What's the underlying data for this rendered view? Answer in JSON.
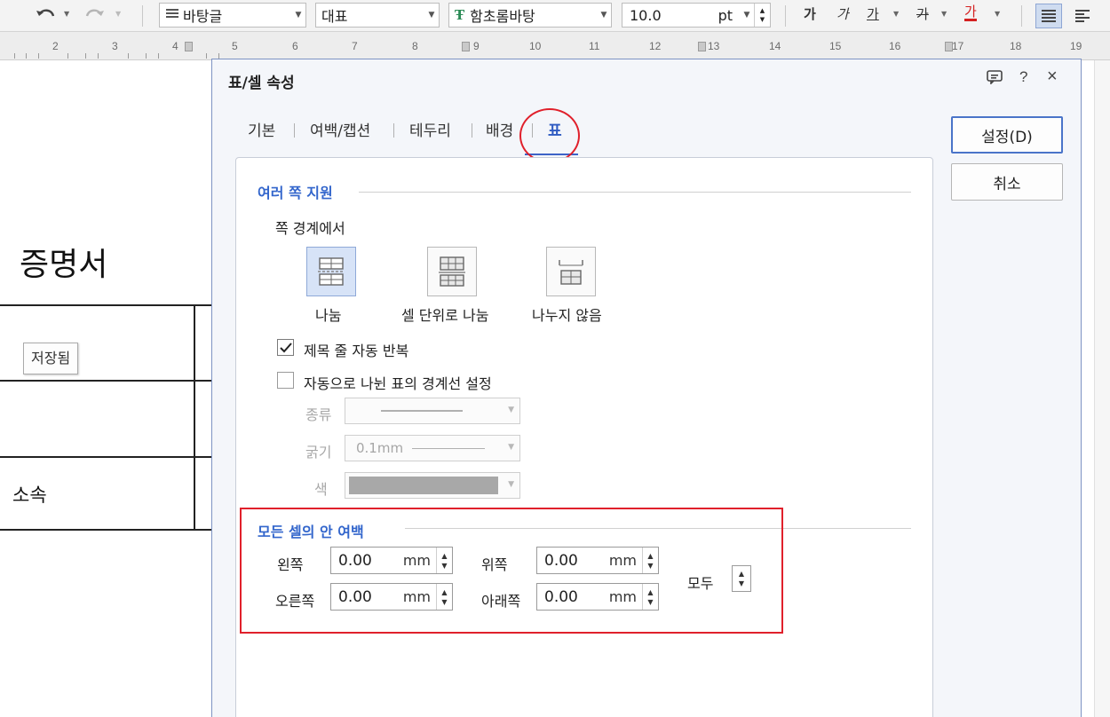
{
  "toolbar": {
    "style_value": "바탕글",
    "outline_value": "대표",
    "font_value": "함초롬바탕",
    "font_size_value": "10.0",
    "font_size_unit": "pt",
    "format_buttons": [
      "가",
      "가",
      "가",
      "가",
      "가"
    ]
  },
  "ruler": {
    "numbers": [
      "2",
      "3",
      "4",
      "5",
      "6",
      "7",
      "8",
      "9",
      "10",
      "11",
      "12",
      "13",
      "14",
      "15",
      "16",
      "17",
      "18",
      "19"
    ]
  },
  "document": {
    "title": "증명서",
    "saved_badge": "저장됨",
    "cell_text": "소속"
  },
  "dialog": {
    "title": "표/셀 속성",
    "help_label": "?",
    "close_label": "×",
    "tabs": [
      "기본",
      "여백/캡션",
      "테두리",
      "배경",
      "표"
    ],
    "active_tab": "표",
    "multi_page": {
      "heading": "여러 쪽 지원",
      "boundary_label": "쪽 경계에서",
      "options": [
        "나눔",
        "셀 단위로 나눔",
        "나누지 않음"
      ],
      "selected_option": "나눔",
      "repeat_header_label": "제목 줄 자동 반복",
      "repeat_header_checked": true,
      "auto_border_label": "자동으로 나뉜 표의 경계선 설정",
      "auto_border_checked": false,
      "type_label": "종류",
      "thickness_label": "굵기",
      "thickness_value": "0.1mm",
      "color_label": "색"
    },
    "cell_margin": {
      "heading": "모든 셀의 안 여백",
      "left_label": "왼쪽",
      "left_value": "0.00",
      "right_label": "오른쪽",
      "right_value": "0.00",
      "top_label": "위쪽",
      "top_value": "0.00",
      "bottom_label": "아래쪽",
      "bottom_value": "0.00",
      "unit": "mm",
      "all_label": "모두"
    },
    "buttons": {
      "ok_label": "설정(D)",
      "cancel_label": "취소"
    }
  },
  "colors": {
    "accent": "#3366cc",
    "highlight": "#e0202b",
    "dialog_border": "#7d93c3"
  }
}
